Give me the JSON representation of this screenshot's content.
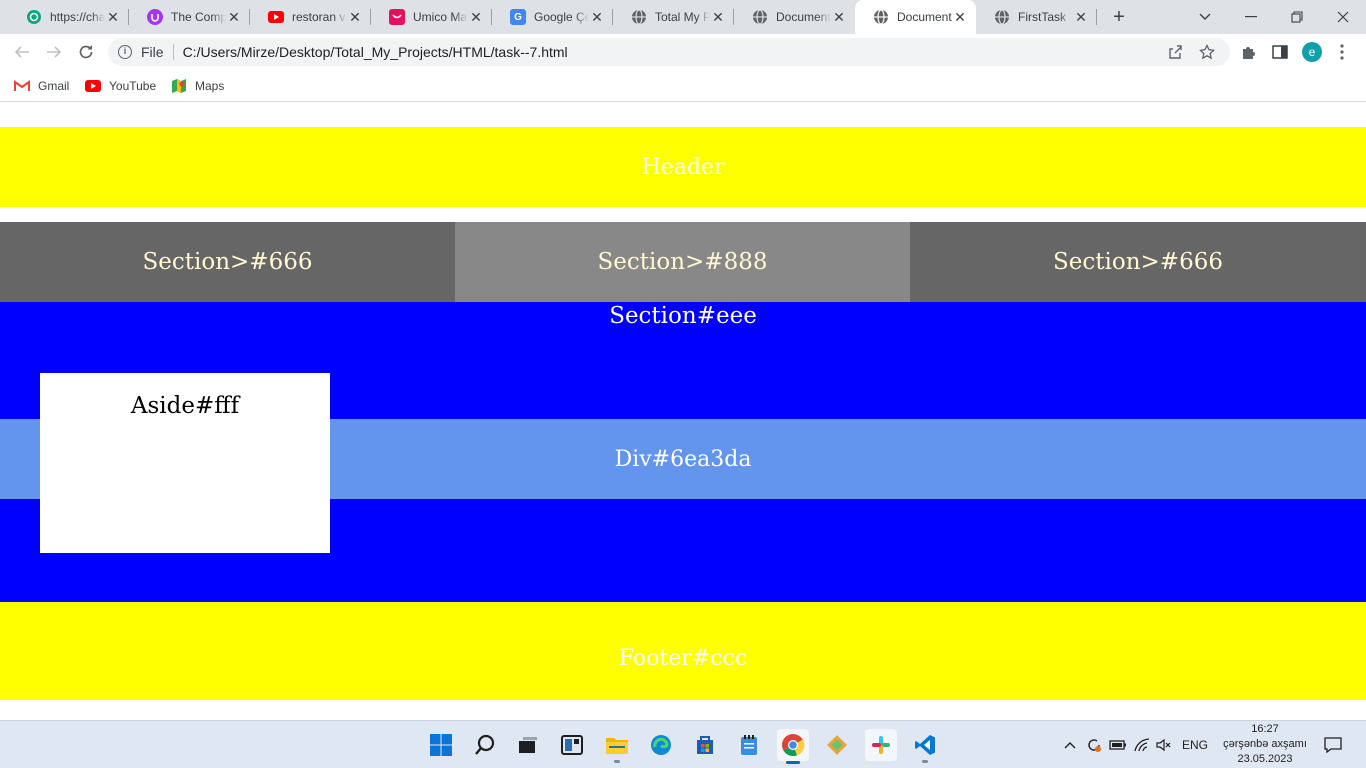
{
  "browser": {
    "tabs": [
      {
        "title": "https://chat.openai.com",
        "icon": "openai-icon"
      },
      {
        "title": "The Complete",
        "icon": "course-icon"
      },
      {
        "title": "restoran veb",
        "icon": "youtube-icon"
      },
      {
        "title": "Umico Market",
        "icon": "umico-icon"
      },
      {
        "title": "Google Çevir",
        "icon": "google-translate-icon"
      },
      {
        "title": "Total My Projects",
        "icon": "globe-icon"
      },
      {
        "title": "Document",
        "icon": "globe-icon"
      },
      {
        "title": "Document",
        "icon": "globe-icon",
        "active": true
      },
      {
        "title": "FirstTask",
        "icon": "globe-icon"
      }
    ],
    "address": {
      "scheme": "File",
      "url": "C:/Users/Mirze/Desktop/Total_My_Projects/HTML/task--7.html"
    },
    "profile_initial": "e",
    "bookmarks": [
      {
        "label": "Gmail",
        "icon": "gmail-icon"
      },
      {
        "label": "YouTube",
        "icon": "youtube-icon"
      },
      {
        "label": "Maps",
        "icon": "maps-icon"
      }
    ]
  },
  "page": {
    "header": "Header",
    "sections": [
      "Section>#666",
      "Section>#888",
      "Section>#666"
    ],
    "section_main": "Section#eee",
    "aside": "Aside#fff",
    "div": "Div#6ea3da",
    "footer": "Footer#ccc"
  },
  "colors": {
    "header_bg": "#ffff00",
    "section_dark": "#666666",
    "section_light": "#888888",
    "main_bg": "#0000ff",
    "div_bg": "#6495ed",
    "aside_bg": "#ffffff",
    "footer_bg": "#ffff00"
  },
  "taskbar": {
    "language": "ENG",
    "time": "16:27",
    "day": "çərşənbə axşamı",
    "date": "23.05.2023"
  }
}
